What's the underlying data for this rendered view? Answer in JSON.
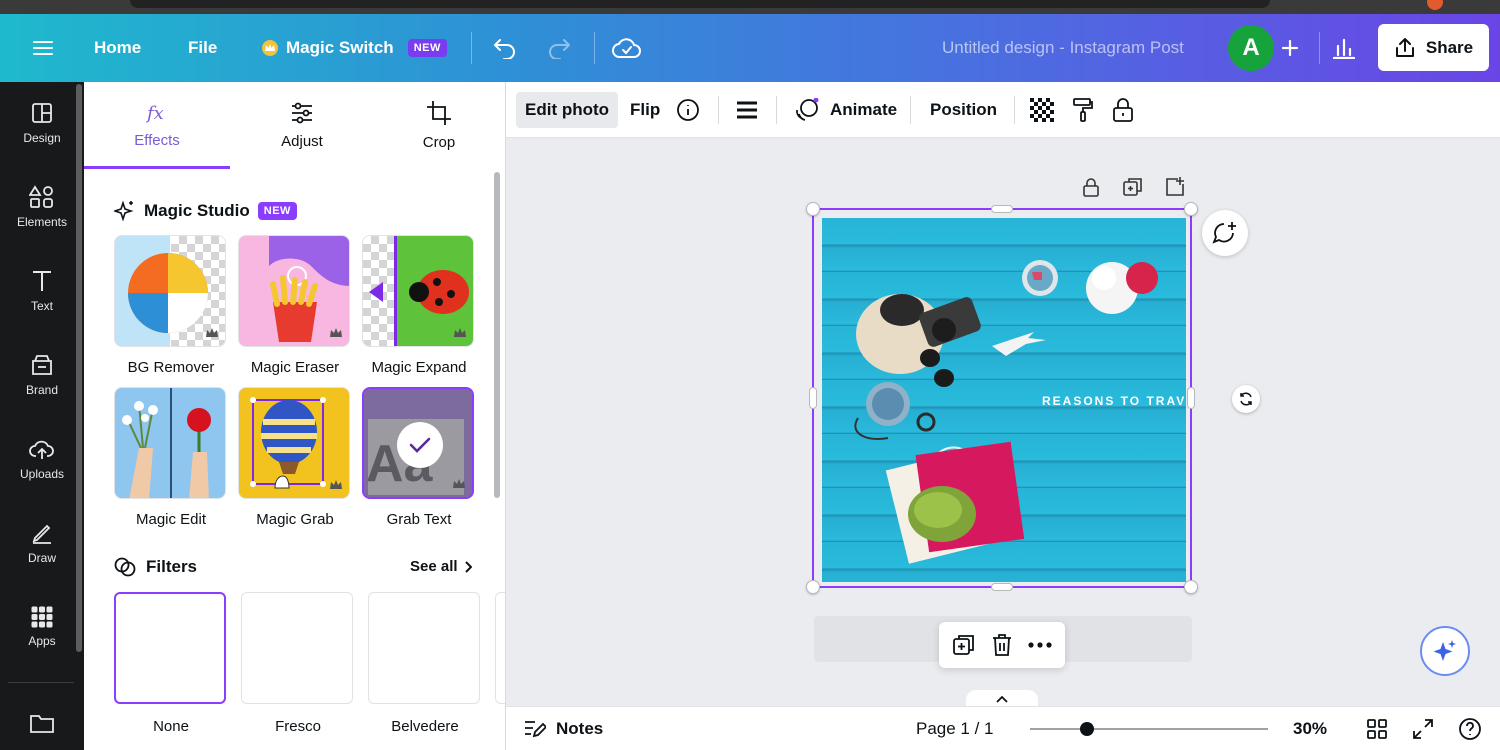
{
  "header": {
    "home_label": "Home",
    "file_label": "File",
    "magic_switch_label": "Magic Switch",
    "new_badge": "NEW",
    "doc_title": "Untitled design - Instagram Post",
    "avatar_initial": "A",
    "share_label": "Share"
  },
  "rail": {
    "items": [
      {
        "label": "Design",
        "icon": "layout-icon"
      },
      {
        "label": "Elements",
        "icon": "shapes-icon"
      },
      {
        "label": "Text",
        "icon": "text-icon"
      },
      {
        "label": "Brand",
        "icon": "brand-icon"
      },
      {
        "label": "Uploads",
        "icon": "upload-cloud-icon"
      },
      {
        "label": "Draw",
        "icon": "pen-icon"
      },
      {
        "label": "Apps",
        "icon": "apps-grid-icon"
      }
    ],
    "bottom_icon": "folder-icon"
  },
  "panel": {
    "tabs": [
      {
        "label": "Effects",
        "icon": "fx-icon",
        "active": true
      },
      {
        "label": "Adjust",
        "icon": "sliders-icon"
      },
      {
        "label": "Crop",
        "icon": "crop-icon"
      }
    ],
    "magic_studio": {
      "heading": "Magic Studio",
      "badge": "NEW",
      "tools": [
        {
          "label": "BG Remover"
        },
        {
          "label": "Magic Eraser"
        },
        {
          "label": "Magic Expand"
        },
        {
          "label": "Magic Edit"
        },
        {
          "label": "Magic Grab"
        },
        {
          "label": "Grab Text",
          "selected": true
        }
      ]
    },
    "filters": {
      "heading": "Filters",
      "see_all": "See all",
      "items": [
        {
          "label": "None",
          "selected": true
        },
        {
          "label": "Fresco"
        },
        {
          "label": "Belvedere"
        }
      ]
    }
  },
  "toolbar": {
    "edit_photo": "Edit photo",
    "flip": "Flip",
    "animate": "Animate",
    "position": "Position"
  },
  "canvas": {
    "title_text": "REASONS TO TRAVEL"
  },
  "footer": {
    "notes": "Notes",
    "page_indicator": "Page 1 / 1",
    "zoom_level": "30%",
    "zoom_fraction": 0.24
  },
  "colors": {
    "accent": "#8b3dff",
    "header_gradient_start": "#1fb9cd",
    "header_gradient_end": "#6a45e6",
    "avatar_bg": "#17a33b",
    "rail_bg": "#18191b"
  }
}
